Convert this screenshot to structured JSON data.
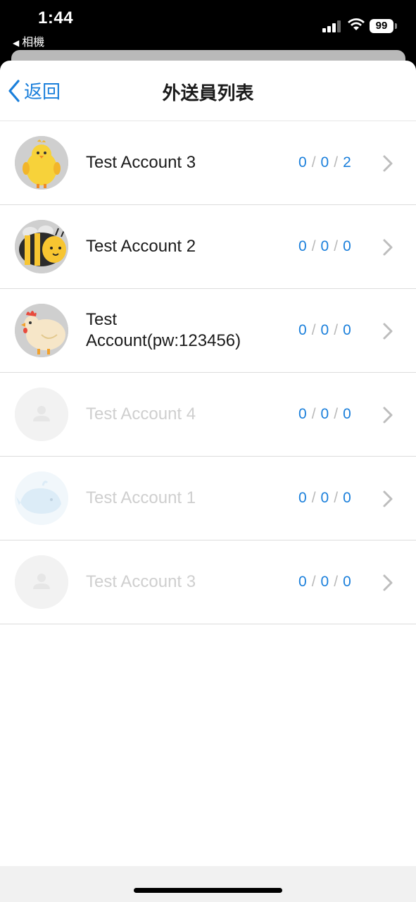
{
  "status_bar": {
    "time": "1:44",
    "back_app": "相機",
    "battery": "99"
  },
  "nav": {
    "back_label": "返回",
    "title": "外送員列表"
  },
  "colors": {
    "accent": "#1a7fdb",
    "separator_slash": "#b9b9b9",
    "text": "#1b1b1b",
    "dim_text": "#cfcfcf"
  },
  "couriers": [
    {
      "name": "Test Account 3",
      "avatar": "chick-icon",
      "counts": [
        "0",
        "0",
        "2"
      ],
      "active": true
    },
    {
      "name": "Test Account 2",
      "avatar": "bee-icon",
      "counts": [
        "0",
        "0",
        "0"
      ],
      "active": true
    },
    {
      "name": "Test Account(pw:123456)",
      "avatar": "chicken-icon",
      "counts": [
        "0",
        "0",
        "0"
      ],
      "active": true
    },
    {
      "name": "Test Account 4",
      "avatar": "default-user-icon",
      "counts": [
        "0",
        "0",
        "0"
      ],
      "active": false
    },
    {
      "name": "Test Account 1",
      "avatar": "whale-icon",
      "counts": [
        "0",
        "0",
        "0"
      ],
      "active": false
    },
    {
      "name": "Test Account 3",
      "avatar": "default-user-icon",
      "counts": [
        "0",
        "0",
        "0"
      ],
      "active": false
    }
  ]
}
